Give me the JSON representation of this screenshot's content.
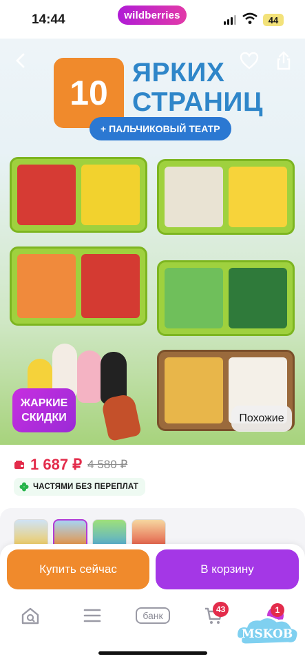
{
  "status_bar": {
    "time": "14:44",
    "brand": "wildberries",
    "battery": "44"
  },
  "hero": {
    "number": "10",
    "title_line1": "ЯРКИХ",
    "title_line2": "СТРАНИЦ",
    "subtitle": "+ ПАЛЬЧИКОВЫЙ ТЕАТР",
    "hot_badge_line1": "ЖАРКИЕ",
    "hot_badge_line2": "СКИДКИ",
    "similar_label": "Похожие"
  },
  "price": {
    "current": "1 687 ₽",
    "old": "4 580 ₽"
  },
  "installment": {
    "label": "ЧАСТЯМИ БЕЗ ПЕРЕПЛАТ"
  },
  "actions": {
    "buy_now": "Купить сейчас",
    "add_to_cart": "В корзину"
  },
  "tabbar": {
    "bank_label": "банк",
    "cart_count": "43",
    "profile_count": "1"
  },
  "watermark": "MSKOB",
  "colors": {
    "accent_orange": "#f08a2c",
    "accent_purple": "#a437e6",
    "price_red": "#e32c4b"
  }
}
